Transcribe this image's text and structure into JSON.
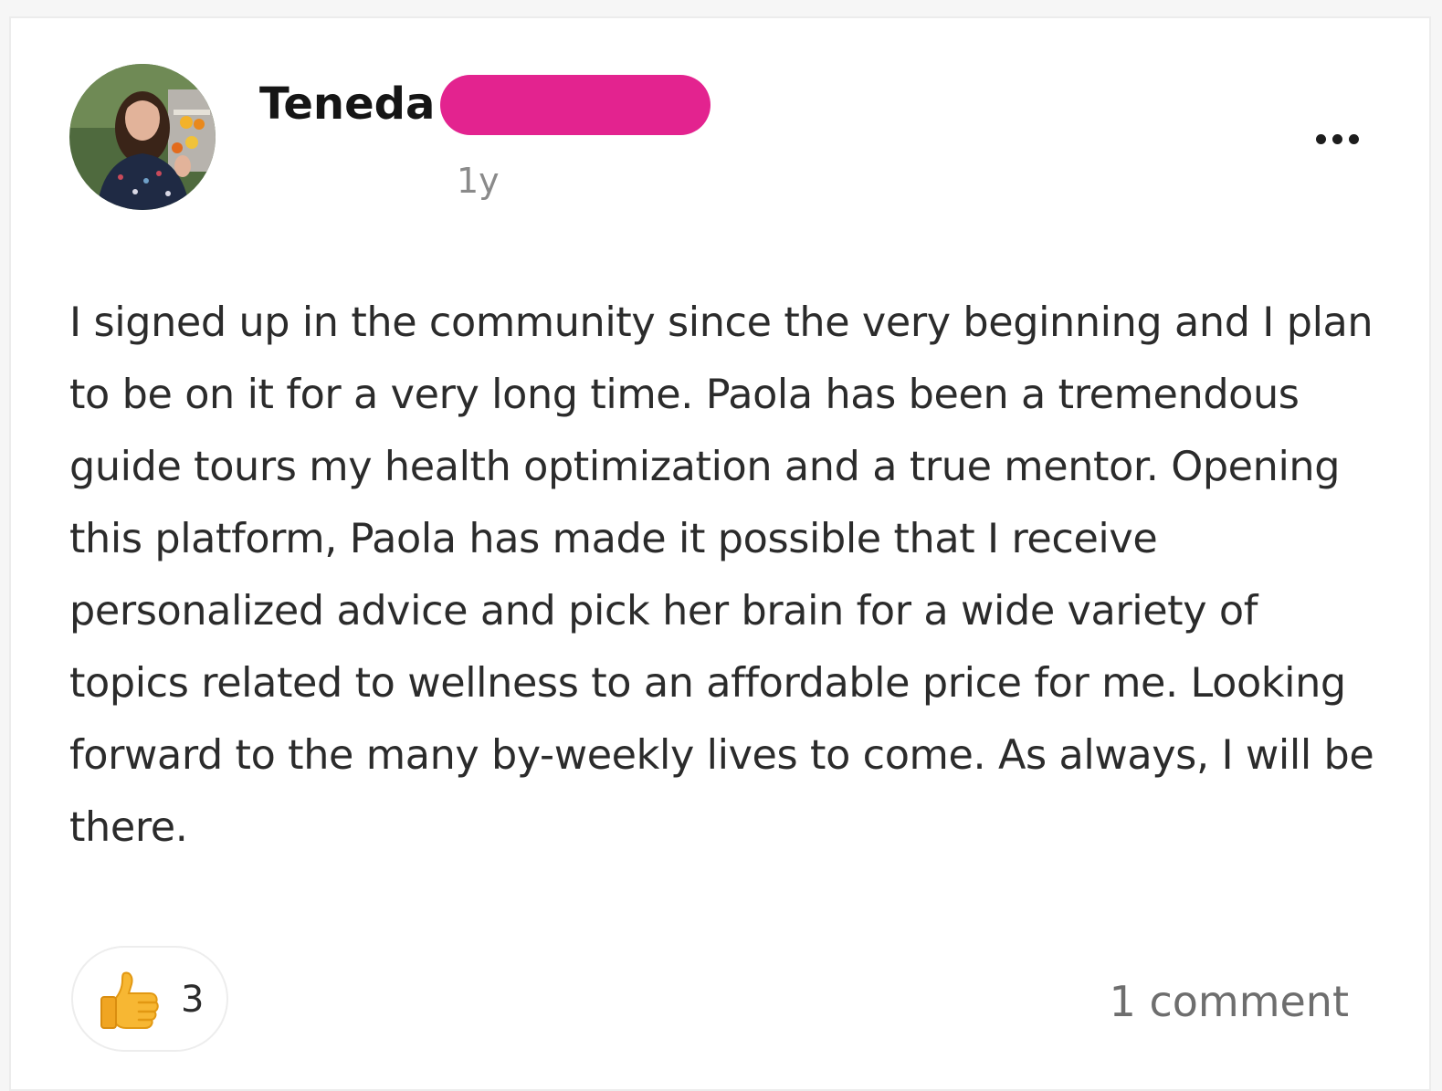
{
  "post": {
    "author_name": "Teneda",
    "timestamp": "1y",
    "body": "I signed up in the community since the very beginning and I plan to be on it for a very long time. Paola has been a tremendous guide tours my health optimization and a true mentor. Opening this platform, Paola has made it possible that I receive personalized advice and pick her brain for a wide variety of topics related to wellness to an affordable price for me. Looking forward to the many by-weekly lives to come. As always, I will be there.",
    "reaction": {
      "icon": "thumbs-up-icon",
      "count": "3"
    },
    "comments_label": "1 comment",
    "menu_icon": "more-horizontal-icon"
  },
  "colors": {
    "redaction": "#e3238f",
    "author_text": "#151515",
    "muted_text": "#8a8a8a",
    "body_text": "#2b2b2b",
    "card_background": "#ffffff",
    "card_border": "#ececec"
  }
}
